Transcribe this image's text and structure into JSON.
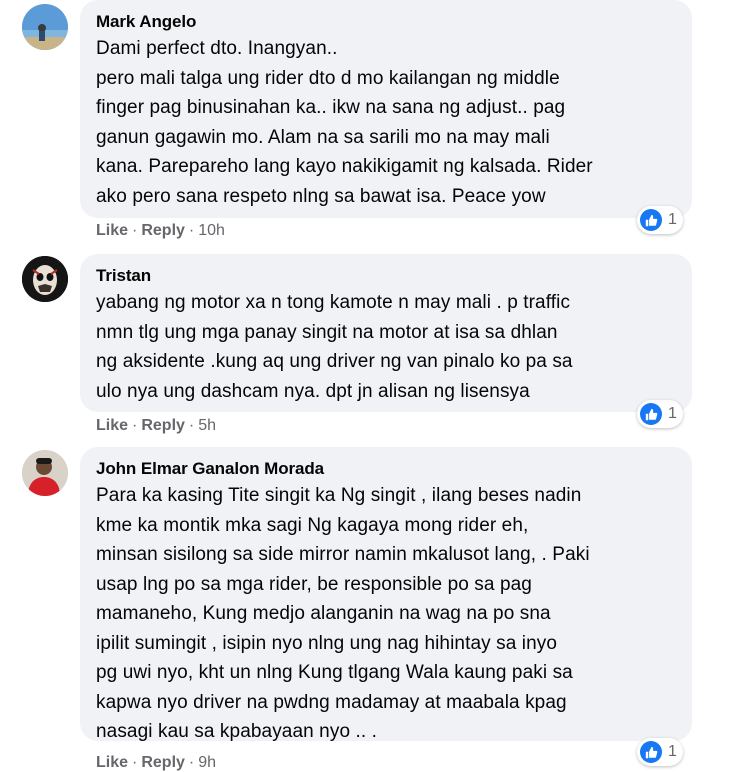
{
  "comments": [
    {
      "author": "Mark Angelo",
      "lines": "Dami perfect dto. Inangyan..\npero mali talga ung rider dto d mo kailangan ng middle\nfinger pag binusinahan ka.. ikw na sana ng adjust.. pag\nganun gagawin mo. Alam na sa sarili mo na may mali\nkana. Parepareho lang kayo nakikigamit ng kalsada. Rider\nako pero sana respeto nlng sa bawat isa. Peace yow",
      "like_label": "Like",
      "reply_label": "Reply",
      "time": "10h",
      "reactions": "1",
      "reaction_icon": "thumbs-up-icon"
    },
    {
      "author": "Tristan",
      "lines": "yabang ng motor xa n tong kamote n may mali . p traffic\nnmn tlg ung mga panay singit na motor at isa sa dhlan\nng aksidente .kung aq ung driver ng van pinalo ko pa sa\nulo nya ung dashcam nya. dpt jn alisan ng lisensya",
      "like_label": "Like",
      "reply_label": "Reply",
      "time": "5h",
      "reactions": "1",
      "reaction_icon": "thumbs-up-icon"
    },
    {
      "author": "John Elmar Ganalon Morada",
      "lines": "Para ka kasing Tite singit ka Ng singit , ilang beses nadin\nkme ka montik mka sagi Ng kagaya mong rider eh,\nminsan sisilong sa side mirror namin mkalusot lang, . Paki\nusap lng po sa mga rider, be responsible po sa pag\nmamaneho, Kung medjo alanganin na wag na po sna\nipilit sumingit , isipin nyo nlng ung nag hihintay sa inyo\npg uwi nyo, kht un nlng Kung tlgang Wala kaung paki sa\nkapwa nyo driver na pwdng madamay at maabala kpag\nnasagi kau sa kpabayaan nyo .. .",
      "like_label": "Like",
      "reply_label": "Reply",
      "time": "9h",
      "reactions": "1",
      "reaction_icon": "thumbs-up-icon"
    }
  ],
  "colors": {
    "bubble": "#f0f2f5",
    "text": "#050505",
    "meta": "#65676b",
    "like_blue": "#1877f2"
  }
}
